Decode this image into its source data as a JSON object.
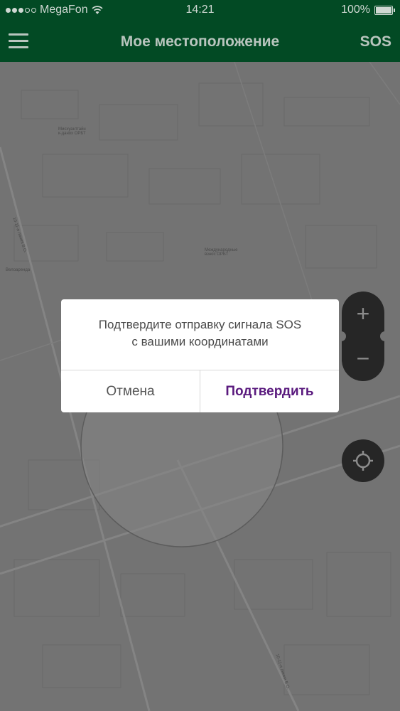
{
  "status_bar": {
    "carrier": "MegaFon",
    "time": "14:21",
    "battery": "100%",
    "signal_bars": 3,
    "signal_total": 5
  },
  "nav": {
    "title": "Мое местоположение",
    "sos_label": "SOS"
  },
  "map": {
    "labels": [
      "Мисхуантгайн\nк-данох ОРБТ",
      "Международные\nвзнос ОРБТ",
      "Велоаренда",
      "10-11-я линия В.О.",
      "10-11-я линия В.О."
    ]
  },
  "controls": {
    "zoom_in": "+",
    "zoom_out": "−"
  },
  "dialog": {
    "message_line1": "Подтвердите отправку сигнала SOS",
    "message_line2": "с вашими координатами",
    "cancel_label": "Отмена",
    "confirm_label": "Подтвердить"
  },
  "colors": {
    "header": "#024a24",
    "confirm_accent": "#5a1a7e",
    "map_overlay": "#737373"
  }
}
